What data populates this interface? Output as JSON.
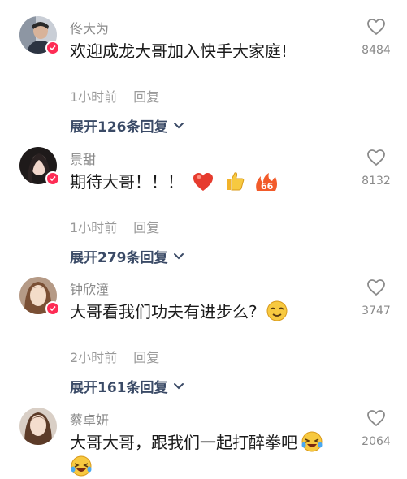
{
  "comments": [
    {
      "username": "佟大为",
      "text": "欢迎成龙大哥加入快手大家庭!",
      "time": "1小时前",
      "reply_label": "回复",
      "expand_label": "展开126条回复",
      "likes": "8484"
    },
    {
      "username": "景甜",
      "text": "期待大哥！！！",
      "time": "1小时前",
      "reply_label": "回复",
      "expand_label": "展开279条回复",
      "likes": "8132"
    },
    {
      "username": "钟欣潼",
      "text": "大哥看我们功夫有进步么?",
      "time": "2小时前",
      "reply_label": "回复",
      "expand_label": "展开161条回复",
      "likes": "3747"
    },
    {
      "username": "蔡卓妍",
      "text": "大哥大哥，跟我们一起打醉拳吧",
      "likes": "2064"
    }
  ],
  "icons": {
    "like": "heart-outline-icon",
    "expand": "chevron-down-icon",
    "badge": "verified-badge-icon"
  },
  "colors": {
    "username": "#8a8a8a",
    "expand_link": "#3a4a66",
    "badge": "#fe2c55"
  }
}
